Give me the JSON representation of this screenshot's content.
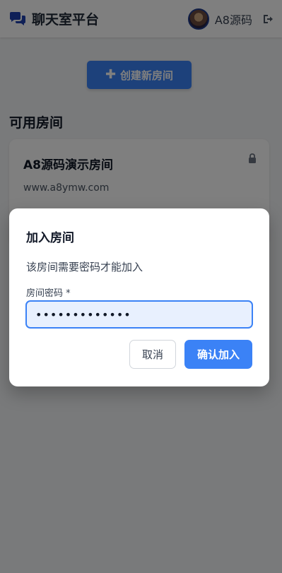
{
  "header": {
    "title": "聊天室平台",
    "icon": "comments-icon",
    "username": "A8源码",
    "logout_icon": "sign-out-icon"
  },
  "main": {
    "create_button": "创建新房间",
    "section_title": "可用房间",
    "rooms": [
      {
        "name": "A8源码演示房间",
        "description": "www.a8ymw.com",
        "locked": true
      }
    ]
  },
  "modal": {
    "title": "加入房间",
    "message": "该房间需要密码才能加入",
    "password_label": "房间密码 *",
    "password_value": "•••••••••••••",
    "cancel_label": "取消",
    "confirm_label": "确认加入"
  },
  "colors": {
    "primary": "#3b82f6",
    "overlay": "rgba(0,0,0,0.5)"
  }
}
